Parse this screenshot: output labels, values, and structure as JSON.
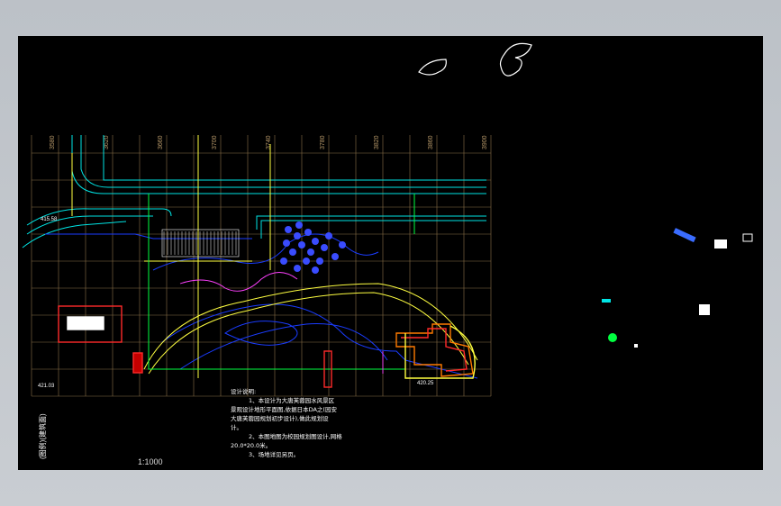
{
  "drawing": {
    "scale": "1:1000",
    "grid_labels": [
      "3580",
      "3620",
      "3660",
      "3700",
      "3740",
      "3780",
      "3820",
      "3860",
      "3900"
    ],
    "elevations": [
      "420.25",
      "419.94",
      "415.58",
      "421.03"
    ],
    "notes": {
      "title": "设计说明:",
      "line1": "1、本设计为大唐芙蓉园水风景区",
      "line2": "景观设计地形平面图,依据日本DA之(园安",
      "line3": "大唐芙蓉园规划初步设计),做此规划设",
      "line4": "计。",
      "line5": "2、本图地图为校园规划图设计,网格",
      "line6": "20.0*20.0米。",
      "line7": "3、场地详见另页。"
    },
    "side_label": "(图例)(建筑面)",
    "colors": {
      "background": "#000000",
      "grid": "#b99a6a",
      "road": "#00e5e5",
      "water": "#1a3cff",
      "building": "#ff2a2a",
      "path": "#ffff40"
    }
  }
}
